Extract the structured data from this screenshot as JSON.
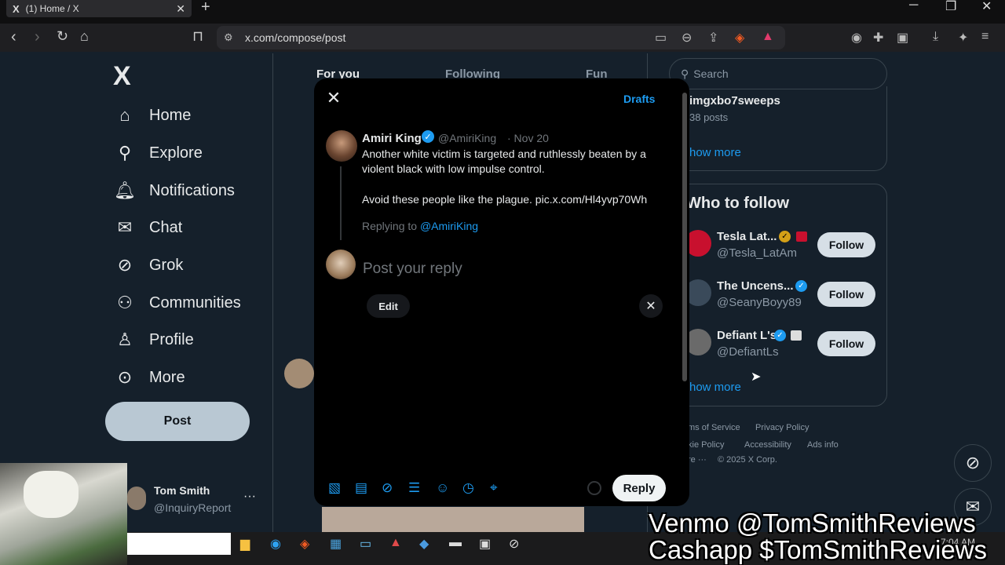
{
  "browser": {
    "tab_title": "(1) Home / X",
    "tab_favicon": "X",
    "url": "x.com/compose/post"
  },
  "nav": {
    "logo": "X",
    "items": [
      {
        "label": "Home",
        "icon": "home-icon"
      },
      {
        "label": "Explore",
        "icon": "search-icon"
      },
      {
        "label": "Notifications",
        "icon": "bell-icon"
      },
      {
        "label": "Chat",
        "icon": "mail-icon"
      },
      {
        "label": "Grok",
        "icon": "grok-icon"
      },
      {
        "label": "Communities",
        "icon": "people-icon"
      },
      {
        "label": "Profile",
        "icon": "person-icon"
      },
      {
        "label": "More",
        "icon": "more-circle-icon"
      }
    ],
    "post_button": "Post",
    "account": {
      "name": "Tom Smith",
      "handle": "@InquiryReport"
    }
  },
  "feed": {
    "tabs": [
      "For you",
      "Following",
      "Fun"
    ]
  },
  "compose": {
    "drafts": "Drafts",
    "original_post": {
      "author": "Amiri King",
      "handle": "@AmiriKing",
      "date": "· Nov 20",
      "text_line1": "Another white victim is targeted and ruthlessly beaten by a",
      "text_line2": "violent black with low impulse control.",
      "text_line3": "Avoid these people like the plague. pic.x.com/Hl4yvp70Wh"
    },
    "replying_prefix": "Replying to",
    "replying_to": "@AmiriKing",
    "placeholder": "Post your reply",
    "edit_label": "Edit",
    "reply_button": "Reply",
    "toolbar_icons": [
      "image-icon",
      "gif-icon",
      "grok-icon",
      "poll-icon",
      "emoji-icon",
      "schedule-icon",
      "location-icon"
    ]
  },
  "sidebar": {
    "search_placeholder": "Search",
    "trend": {
      "name": "imgxbo7sweeps",
      "count": "38 posts",
      "show_more": "how more"
    },
    "who_to_follow_title": "Who to follow",
    "suggestions": [
      {
        "name": "Tesla Lat...",
        "handle": "@Tesla_LatAm",
        "follow": "Follow",
        "avatar_color": "#c8102e"
      },
      {
        "name": "The Uncens...",
        "handle": "@SeanyBoyy89",
        "follow": "Follow",
        "avatar_color": "#3a4a5a"
      },
      {
        "name": "Defiant L's",
        "handle": "@DefiantLs",
        "follow": "Follow",
        "avatar_color": "#6a6a6a"
      }
    ],
    "show_more": "how more",
    "footer": {
      "terms": "ms of Service",
      "privacy": "Privacy Policy",
      "cookie": "kie Policy",
      "accessibility": "Accessibility",
      "ads": "Ads info",
      "more": "re ···",
      "copyright": "© 2025 X Corp."
    }
  },
  "taskbar": {
    "time": "7:04 AM"
  },
  "overlay": {
    "line1": "Venmo @TomSmithReviews",
    "line2": "Cashapp $TomSmithReviews"
  }
}
